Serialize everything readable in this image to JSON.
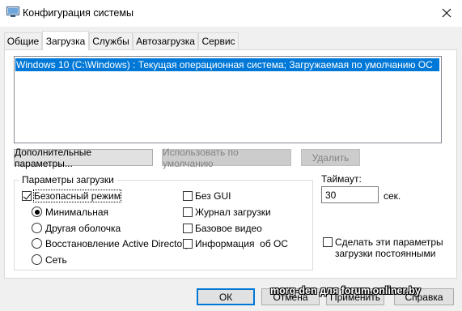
{
  "window": {
    "title": "Конфигурация системы",
    "close_icon": "close-icon",
    "app_icon": "msconfig-icon"
  },
  "tabs": [
    {
      "label": "Общие",
      "active": false
    },
    {
      "label": "Загрузка",
      "active": true
    },
    {
      "label": "Службы",
      "active": false
    },
    {
      "label": "Автозагрузка",
      "active": false
    },
    {
      "label": "Сервис",
      "active": false
    }
  ],
  "os_list": {
    "items": [
      "Windows 10 (C:\\Windows) : Текущая операционная система; Загружаемая по умолчанию ОС"
    ],
    "selected_index": 0
  },
  "buttons": {
    "advanced": "Дополнительные параметры...",
    "set_default": "Использовать по умолчанию",
    "delete": "Удалить",
    "ok": "ОК",
    "cancel": "Отмена",
    "apply": "Применить",
    "help": "Справка"
  },
  "boot_options": {
    "title": "Параметры загрузки",
    "safe_boot": {
      "label": "Безопасный режим",
      "checked": true
    },
    "radios": [
      {
        "label": "Минимальная",
        "checked": true
      },
      {
        "label": "Другая оболочка",
        "checked": false
      },
      {
        "label": "Восстановление Active Directory",
        "checked": false
      },
      {
        "label": "Сеть",
        "checked": false
      }
    ],
    "checks": [
      {
        "label": "Без GUI",
        "checked": false
      },
      {
        "label": "Журнал загрузки",
        "checked": false
      },
      {
        "label": "Базовое видео",
        "checked": false
      },
      {
        "label": "Информация  об ОС",
        "checked": false
      }
    ]
  },
  "timeout": {
    "label": "Таймаут:",
    "value": "30",
    "unit": "сек."
  },
  "permanent": {
    "label_line1": "Сделать эти параметры",
    "label_line2": "загрузки постоянными",
    "checked": false
  },
  "watermark": "morg-den для forum.onliner.by"
}
